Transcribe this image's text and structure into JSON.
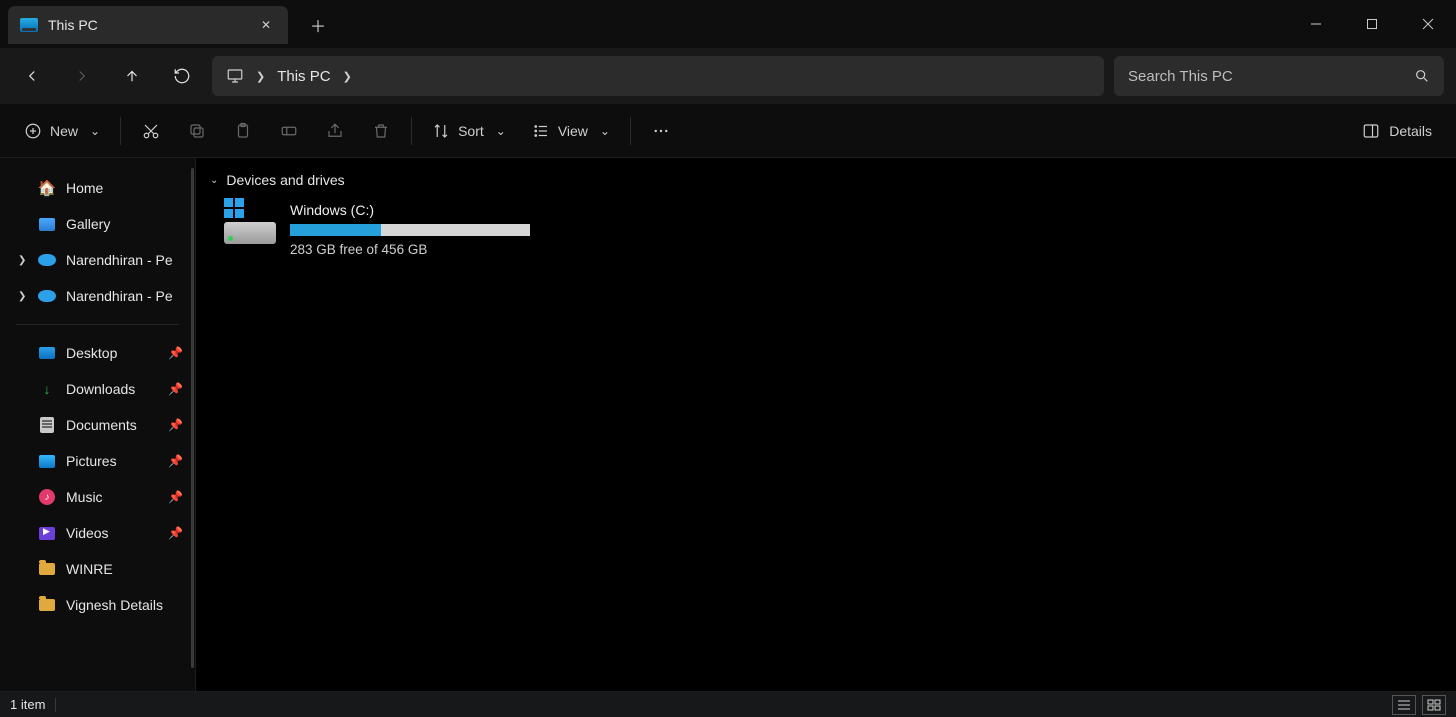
{
  "tab": {
    "title": "This PC"
  },
  "address": {
    "location": "This PC"
  },
  "search": {
    "placeholder": "Search This PC"
  },
  "toolbar": {
    "new": "New",
    "sort": "Sort",
    "view": "View",
    "details": "Details"
  },
  "sidebar": {
    "top": [
      {
        "label": "Home",
        "icon": "home"
      },
      {
        "label": "Gallery",
        "icon": "gallery"
      },
      {
        "label": "Narendhiran - Pe",
        "icon": "cloud",
        "chevron": true
      },
      {
        "label": "Narendhiran - Pe",
        "icon": "cloud",
        "chevron": true
      }
    ],
    "pinned": [
      {
        "label": "Desktop",
        "icon": "desktop",
        "pinned": true
      },
      {
        "label": "Downloads",
        "icon": "download",
        "pinned": true
      },
      {
        "label": "Documents",
        "icon": "doc",
        "pinned": true
      },
      {
        "label": "Pictures",
        "icon": "pic",
        "pinned": true
      },
      {
        "label": "Music",
        "icon": "music",
        "pinned": true
      },
      {
        "label": "Videos",
        "icon": "video",
        "pinned": true
      },
      {
        "label": "WINRE",
        "icon": "folder",
        "pinned": false
      },
      {
        "label": "Vignesh Details",
        "icon": "folder",
        "pinned": false
      }
    ]
  },
  "content": {
    "group_title": "Devices and drives",
    "drives": [
      {
        "name": "Windows (C:)",
        "free_text": "283 GB free of 456 GB",
        "used_percent": 38
      }
    ]
  },
  "status": {
    "item_count": "1 item"
  }
}
